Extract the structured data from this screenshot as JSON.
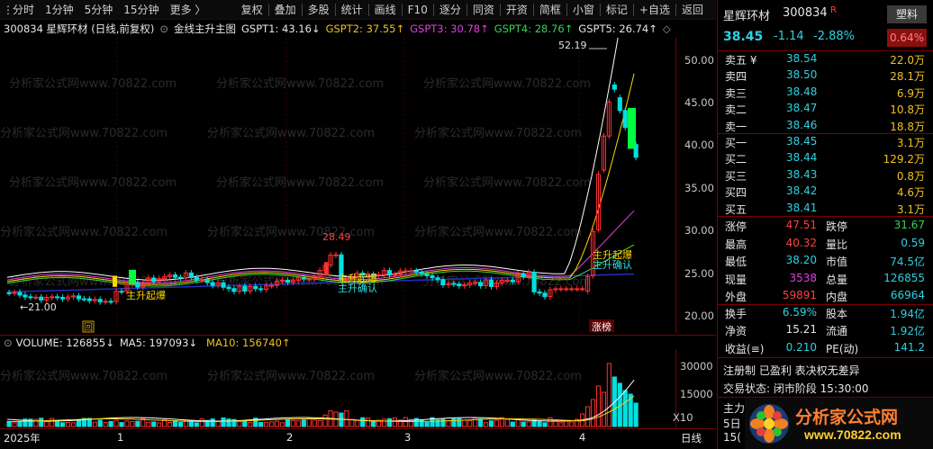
{
  "toolbar": {
    "left_items": [
      "分时",
      "1分钟",
      "5分钟",
      "15分钟",
      "更多 〉"
    ],
    "right_items": [
      "复权",
      "叠加",
      "多股",
      "统计",
      "画线",
      "F10",
      "逐分",
      "同资",
      "开资",
      "简框",
      "小窗",
      "标记",
      "+自选",
      "返回"
    ]
  },
  "infoline": {
    "stock": "300834 星辉环材 (日线,前复权)",
    "indicator": "金线主升主图",
    "gspt1": "GSPT1: 43.16↓",
    "gspt2": "GSPT2: 37.55↑",
    "gspt3": "GSPT3: 30.78↑",
    "gspt4": "GSPT4: 28.76↑",
    "gspt5": "GSPT5: 26.74↑"
  },
  "price_axis": [
    "50.00",
    "45.00",
    "40.00",
    "35.00",
    "30.00",
    "25.00",
    "20.00"
  ],
  "annotations": {
    "low_label": "←21.00",
    "high_label_mid": "28.49",
    "high_label_peak": "52.19",
    "signal1": "主升起爆",
    "signal2": "主升起爆",
    "signal3": "主升起爆",
    "signal4": "主升确认",
    "signal5": "主升确认",
    "tag_zhangbang": "涨榜",
    "tag_box": "回"
  },
  "volume": {
    "title": "VOLUME: 126855↓",
    "ma5": "MA5: 197093↓",
    "ma10": "MA10: 156740↑",
    "axis": [
      "30000",
      "15000"
    ],
    "unit": "X10"
  },
  "dates": {
    "year": "2025年",
    "months": [
      "1",
      "2",
      "3",
      "4"
    ],
    "period": "日线"
  },
  "quote": {
    "name": "星辉环材",
    "code": "300834",
    "r_mark": "R",
    "sector": "塑料",
    "price": "38.45",
    "change": "-1.14",
    "change_pct": "-2.88%",
    "sector_pct": "0.64%",
    "asks": [
      {
        "label": "卖五 ¥",
        "price": "38.54",
        "vol": "22.0万"
      },
      {
        "label": "卖四",
        "price": "38.50",
        "vol": "28.1万"
      },
      {
        "label": "卖三",
        "price": "38.48",
        "vol": "6.9万"
      },
      {
        "label": "卖二",
        "price": "38.47",
        "vol": "10.8万"
      },
      {
        "label": "卖一",
        "price": "38.46",
        "vol": "18.8万"
      }
    ],
    "bids": [
      {
        "label": "买一",
        "price": "38.45",
        "vol": "3.1万"
      },
      {
        "label": "买二",
        "price": "38.44",
        "vol": "129.2万"
      },
      {
        "label": "买三",
        "price": "38.43",
        "vol": "0.8万"
      },
      {
        "label": "买四",
        "price": "38.42",
        "vol": "4.6万"
      },
      {
        "label": "买五",
        "price": "38.41",
        "vol": "3.1万"
      }
    ],
    "stats": [
      {
        "l1": "涨停",
        "v1": "47.51",
        "l2": "跌停",
        "v2": "31.67"
      },
      {
        "l1": "最高",
        "v1": "40.32",
        "l2": "量比",
        "v2": "0.59"
      },
      {
        "l1": "最低",
        "v1": "38.20",
        "l2": "市值",
        "v2": "74.5亿"
      },
      {
        "l1": "现量",
        "v1": "3538",
        "l2": "总量",
        "v2": "126855"
      },
      {
        "l1": "外盘",
        "v1": "59891",
        "l2": "内盘",
        "v2": "66964"
      }
    ],
    "fund": [
      {
        "l1": "换手",
        "v1": "6.59%",
        "l2": "股本",
        "v2": "1.94亿"
      },
      {
        "l1": "净资",
        "v1": "15.21",
        "l2": "流通",
        "v2": "1.92亿"
      },
      {
        "l1": "收益(≡)",
        "v1": "0.210",
        "l2": "PE(动)",
        "v2": "141.2"
      }
    ],
    "reg": "注册制 已盈利 表决权无差异",
    "status": "交易状态: 闭市阶段 15:30:00",
    "extra1": "主力",
    "extra2": "5日",
    "extra3": "15("
  },
  "logo": {
    "title": "分析家公式网",
    "url": "www.70822.com"
  },
  "watermark": "分析家公式网www.70822.com",
  "colors": {
    "up": "#ff3030",
    "down": "#00e0e0",
    "green_bar": "#00ff40",
    "gspt1": "#ffffff",
    "gspt2": "#ffd700",
    "gspt3": "#e040e0",
    "gspt4": "#40e040",
    "gspt5": "#c8c8c8"
  }
}
